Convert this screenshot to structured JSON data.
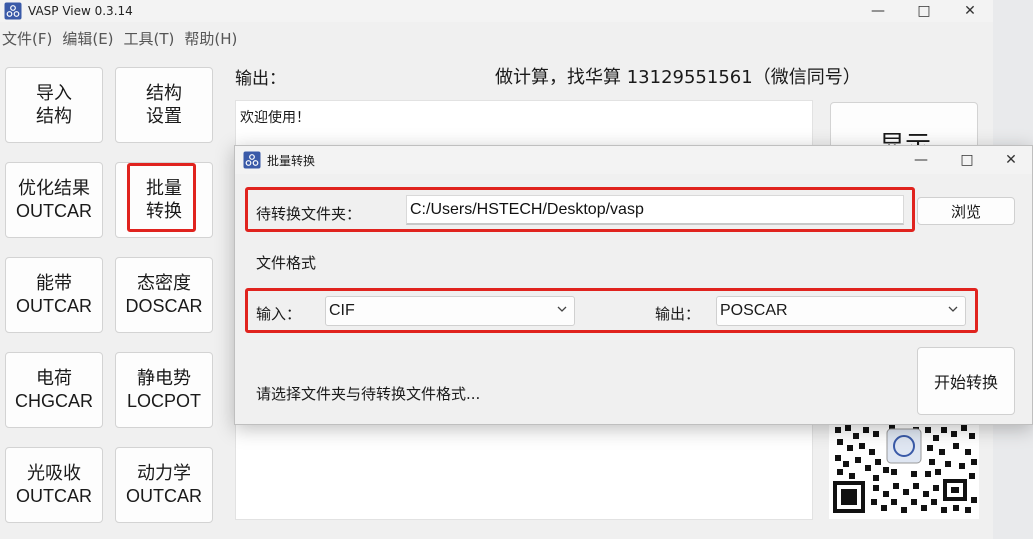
{
  "main_window": {
    "title": "VASP View 0.3.14",
    "menu": [
      "文件(F)",
      "编辑(E)",
      "工具(T)",
      "帮助(H)"
    ],
    "buttons": [
      {
        "line1": "导入",
        "line2": "结构"
      },
      {
        "line1": "结构",
        "line2": "设置"
      },
      {
        "line1": "优化结果",
        "line2": "OUTCAR"
      },
      {
        "line1": "批量",
        "line2": "转换"
      },
      {
        "line1": "能带",
        "line2": "OUTCAR"
      },
      {
        "line1": "态密度",
        "line2": "DOSCAR"
      },
      {
        "line1": "电荷",
        "line2": "CHGCAR"
      },
      {
        "line1": "静电势",
        "line2": "LOCPOT"
      },
      {
        "line1": "光吸收",
        "line2": "OUTCAR"
      },
      {
        "line1": "动力学",
        "line2": "OUTCAR"
      }
    ],
    "output_label": "输出：",
    "contact": "做计算，找华算 13129551561（微信同号）",
    "output_text": "欢迎使用！",
    "display_button": "显示"
  },
  "dialog": {
    "title": "批量转换",
    "folder_label": "待转换文件夹：",
    "folder_value": "C:/Users/HSTECH/Desktop/vasp",
    "browse_label": "浏览",
    "format_label": "文件格式",
    "input_label": "输入：",
    "input_value": "CIF",
    "output_label": "输出：",
    "output_value": "POSCAR",
    "status": "请选择文件夹与待转换文件格式...",
    "start_label": "开始转换"
  },
  "colors": {
    "highlight": "#e0231e",
    "icon_blue": "#3a5aa8"
  },
  "icons": [
    "app-icon",
    "minimize-icon",
    "maximize-icon",
    "close-icon",
    "chevron-down-icon",
    "qr-code"
  ]
}
